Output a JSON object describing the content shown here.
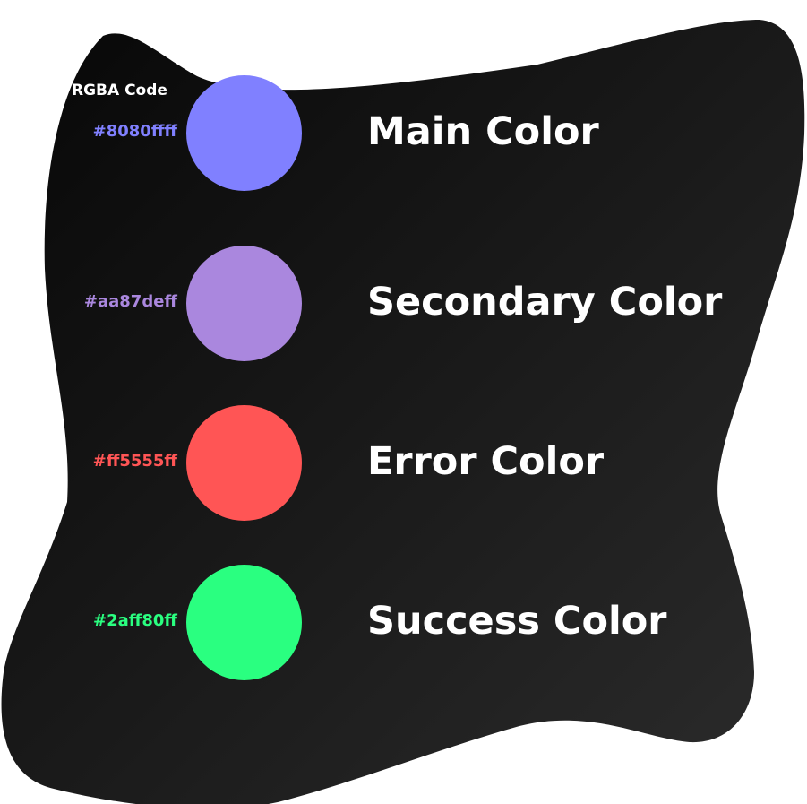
{
  "header": {
    "label": "RGBA Code"
  },
  "swatches": [
    {
      "name": "Main Color",
      "code": "#8080ffff",
      "color": "#8080ff"
    },
    {
      "name": "Secondary Color",
      "code": "#aa87deff",
      "color": "#aa87de"
    },
    {
      "name": "Error Color",
      "code": "#ff5555ff",
      "color": "#ff5555"
    },
    {
      "name": "Success Color",
      "code": "#2aff80ff",
      "color": "#2aff80"
    }
  ],
  "background": {
    "start_color": "#070707",
    "end_color": "#2c2c2c"
  }
}
